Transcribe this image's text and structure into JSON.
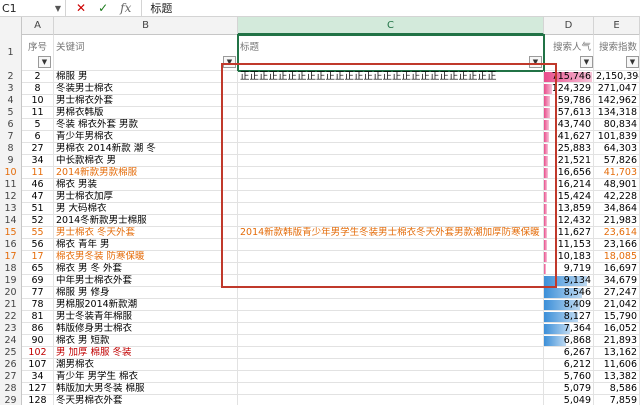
{
  "formula_bar": {
    "name_box": "C1",
    "cancel_icon": "✕",
    "enter_icon": "✓",
    "fx_icon": "fx",
    "value": "标题"
  },
  "columns": [
    "A",
    "B",
    "C",
    "D",
    "E"
  ],
  "headers": {
    "a": "序号",
    "b": "关键词",
    "c": "标题",
    "d": "搜索人气",
    "e": "搜索指数"
  },
  "rows": [
    {
      "n": "2",
      "a": "2",
      "b": "棉服 男",
      "c": "正正正正正正正正正正正正正正正正正正正正正正正正正正正",
      "d": "715,746",
      "e": "2,150,394",
      "bar": 1.0,
      "barc": "#e84c8b",
      "bc": "",
      "ec": ""
    },
    {
      "n": "3",
      "a": "8",
      "b": "冬装男士棉衣",
      "c": "",
      "d": "124,329",
      "e": "271,047",
      "bar": 0.17,
      "barc": "#e84c8b",
      "bc": "",
      "ec": ""
    },
    {
      "n": "4",
      "a": "10",
      "b": "男士棉衣外套",
      "c": "",
      "d": "59,786",
      "e": "142,962",
      "bar": 0.12,
      "barc": "#e84c8b",
      "bc": "",
      "ec": ""
    },
    {
      "n": "5",
      "a": "11",
      "b": "男棉衣韩版",
      "c": "",
      "d": "57,613",
      "e": "134,318",
      "bar": 0.12,
      "barc": "#e84c8b",
      "bc": "",
      "ec": ""
    },
    {
      "n": "6",
      "a": "5",
      "b": "冬装 棉衣外套 男款",
      "c": "",
      "d": "43,740",
      "e": "80,834",
      "bar": 0.1,
      "barc": "#e84c8b",
      "bc": "",
      "ec": ""
    },
    {
      "n": "7",
      "a": "6",
      "b": "青少年男棉衣",
      "c": "",
      "d": "41,627",
      "e": "101,839",
      "bar": 0.1,
      "barc": "#e84c8b",
      "bc": "",
      "ec": ""
    },
    {
      "n": "8",
      "a": "27",
      "b": "男棉衣 2014新款 潮 冬",
      "c": "",
      "d": "25,883",
      "e": "64,303",
      "bar": 0.09,
      "barc": "#e84c8b",
      "bc": "",
      "ec": ""
    },
    {
      "n": "9",
      "a": "34",
      "b": "中长款棉衣 男",
      "c": "",
      "d": "21,521",
      "e": "57,826",
      "bar": 0.08,
      "barc": "#e84c8b",
      "bc": "",
      "ec": ""
    },
    {
      "n": "10",
      "a": "11",
      "b": "2014新款男款棉服",
      "c": "",
      "d": "16,656",
      "e": "41,703",
      "bar": 0.08,
      "barc": "#e84c8b",
      "bc": "orange",
      "ec": "orange"
    },
    {
      "n": "11",
      "a": "46",
      "b": "棉衣 男装",
      "c": "",
      "d": "16,214",
      "e": "48,901",
      "bar": 0.07,
      "barc": "#e84c8b",
      "bc": "",
      "ec": ""
    },
    {
      "n": "12",
      "a": "47",
      "b": "男士棉衣加厚",
      "c": "",
      "d": "15,424",
      "e": "42,228",
      "bar": 0.07,
      "barc": "#e84c8b",
      "bc": "",
      "ec": ""
    },
    {
      "n": "13",
      "a": "51",
      "b": "男 大码棉衣",
      "c": "",
      "d": "13,859",
      "e": "34,864",
      "bar": 0.07,
      "barc": "#e84c8b",
      "bc": "",
      "ec": ""
    },
    {
      "n": "14",
      "a": "52",
      "b": "2014冬新款男士棉服",
      "c": "",
      "d": "12,432",
      "e": "21,983",
      "bar": 0.06,
      "barc": "#e84c8b",
      "bc": "",
      "ec": ""
    },
    {
      "n": "15",
      "a": "55",
      "b": "男士棉衣 冬天外套",
      "c": "2014新款韩版青少年男学生冬装男士棉衣冬天外套男款潮加厚防寒保暖",
      "d": "11,627",
      "e": "23,614",
      "bar": 0.06,
      "barc": "#e84c8b",
      "bc": "orange",
      "ec": "orange"
    },
    {
      "n": "16",
      "a": "56",
      "b": "棉衣 青年 男",
      "c": "",
      "d": "11,153",
      "e": "23,166",
      "bar": 0.06,
      "barc": "#e84c8b",
      "bc": "",
      "ec": ""
    },
    {
      "n": "17",
      "a": "17",
      "b": "棉衣男冬装 防寒保暖",
      "c": "",
      "d": "10,183",
      "e": "18,085",
      "bar": 0.06,
      "barc": "#e84c8b",
      "bc": "orange",
      "ec": "orange"
    },
    {
      "n": "18",
      "a": "65",
      "b": "棉衣 男 冬 外套",
      "c": "",
      "d": "9,719",
      "e": "16,697",
      "bar": 0.05,
      "barc": "#e84c8b",
      "bc": "",
      "ec": ""
    },
    {
      "n": "19",
      "a": "69",
      "b": "中年男士棉衣外套",
      "c": "",
      "d": "9,134",
      "e": "34,679",
      "bar": 0.9,
      "barc": "#3c8fd8",
      "bc": "",
      "ec": ""
    },
    {
      "n": "20",
      "a": "77",
      "b": "棉服 男 修身",
      "c": "",
      "d": "8,546",
      "e": "27,247",
      "bar": 0.8,
      "barc": "#3c8fd8",
      "bc": "",
      "ec": ""
    },
    {
      "n": "21",
      "a": "78",
      "b": "男棉服2014新款潮",
      "c": "",
      "d": "8,409",
      "e": "21,042",
      "bar": 0.75,
      "barc": "#3c8fd8",
      "bc": "",
      "ec": ""
    },
    {
      "n": "22",
      "a": "81",
      "b": "男士冬装青年棉服",
      "c": "",
      "d": "8,127",
      "e": "15,790",
      "bar": 0.7,
      "barc": "#3c8fd8",
      "bc": "",
      "ec": ""
    },
    {
      "n": "23",
      "a": "86",
      "b": "韩版修身男士棉衣",
      "c": "",
      "d": "7,364",
      "e": "16,052",
      "bar": 0.55,
      "barc": "#3c8fd8",
      "bc": "",
      "ec": ""
    },
    {
      "n": "24",
      "a": "90",
      "b": "棉衣 男 短款",
      "c": "",
      "d": "6,868",
      "e": "21,893",
      "bar": 0.45,
      "barc": "#3c8fd8",
      "bc": "",
      "ec": ""
    },
    {
      "n": "25",
      "a": "102",
      "b": "男 加厚 棉服 冬装",
      "c": "",
      "d": "6,267",
      "e": "13,162",
      "bar": 0.0,
      "barc": "#3c8fd8",
      "bc": "red",
      "ec": ""
    },
    {
      "n": "26",
      "a": "107",
      "b": "潮男棉衣",
      "c": "",
      "d": "6,212",
      "e": "11,606",
      "bar": 0.0,
      "barc": "#3c8fd8",
      "bc": "",
      "ec": ""
    },
    {
      "n": "27",
      "a": "34",
      "b": "青少年 男学生 棉衣",
      "c": "",
      "d": "5,760",
      "e": "13,382",
      "bar": 0.0,
      "barc": "#3c8fd8",
      "bc": "",
      "ec": ""
    },
    {
      "n": "28",
      "a": "127",
      "b": "韩版加大男冬装 棉服",
      "c": "",
      "d": "5,079",
      "e": "8,586",
      "bar": 0.0,
      "barc": "#3c8fd8",
      "bc": "",
      "ec": ""
    },
    {
      "n": "29",
      "a": "128",
      "b": "冬天男棉衣外套",
      "c": "",
      "d": "5,049",
      "e": "7,859",
      "bar": 0.0,
      "barc": "#3c8fd8",
      "bc": "",
      "ec": ""
    }
  ],
  "colors": {
    "selection_outline": "#c0392b",
    "active_cell": "#217346",
    "pink_bar": "#e84c8b",
    "blue_bar": "#3c8fd8",
    "orange_text": "#e46c0a",
    "red_text": "#c00000"
  }
}
